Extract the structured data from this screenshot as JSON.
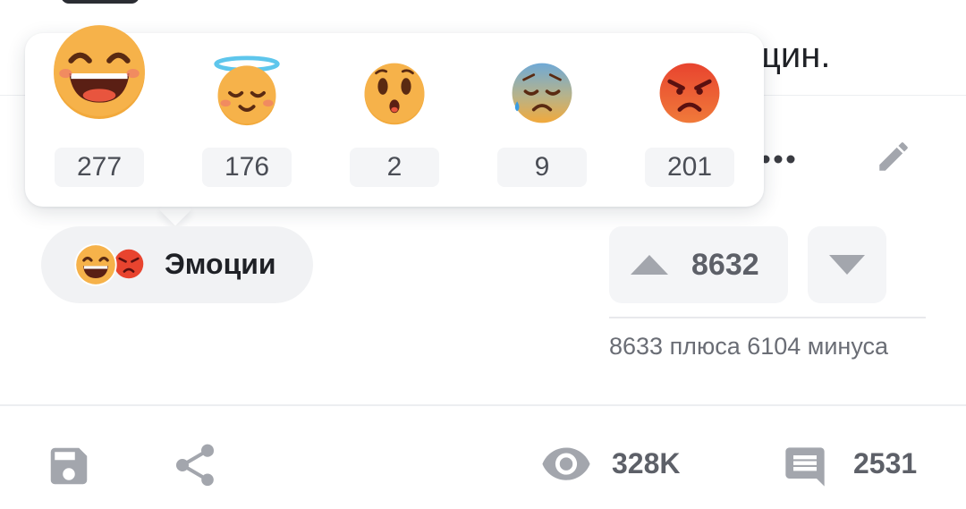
{
  "article": {
    "text_tail": "щин."
  },
  "reactions": {
    "items": [
      {
        "icon": "laughing-face-icon",
        "count": "277"
      },
      {
        "icon": "angel-face-icon",
        "count": "176"
      },
      {
        "icon": "surprised-face-icon",
        "count": "2"
      },
      {
        "icon": "sad-face-icon",
        "count": "9"
      },
      {
        "icon": "angry-face-icon",
        "count": "201"
      }
    ]
  },
  "emotions_button": {
    "label": "Эмоции"
  },
  "rating": {
    "score": "8632",
    "summary": "8633 плюса 6104 минуса"
  },
  "footer": {
    "views": "328K",
    "comments": "2531"
  },
  "colors": {
    "face_fill": "#f2a93b",
    "angry_fill": "#e8442f",
    "sad_fill": "#7db3d8",
    "icon_gray": "#a3a6ad",
    "halo": "#5ec6ec"
  }
}
